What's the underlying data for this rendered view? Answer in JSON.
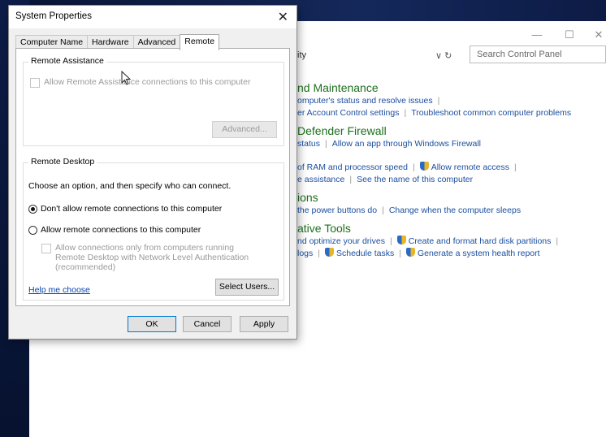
{
  "control_panel": {
    "address": "ity",
    "search_placeholder": "Search Control Panel",
    "minimize": "—",
    "maximize": "☐",
    "close": "✕",
    "sections": [
      {
        "title": "nd Maintenance",
        "rows": [
          [
            "omputer's status and resolve issues"
          ],
          [
            "er Account Control settings",
            "Troubleshoot common computer problems"
          ]
        ]
      },
      {
        "title": "Defender Firewall",
        "rows": [
          [
            "status",
            "Allow an app through Windows Firewall"
          ]
        ]
      },
      {
        "title": "",
        "rows": [
          [
            "of RAM and processor speed",
            "Allow remote access"
          ],
          [
            "e assistance",
            "See the name of this computer"
          ]
        ]
      },
      {
        "title": "ions",
        "rows": [
          [
            "the power buttons do",
            "Change when the computer sleeps"
          ]
        ]
      },
      {
        "title": "ative Tools",
        "rows": [
          [
            "nd optimize your drives",
            "Create and format hard disk partitions"
          ],
          [
            "logs",
            "Schedule tasks",
            "Generate a system health report"
          ]
        ]
      }
    ]
  },
  "dialog": {
    "title": "System Properties",
    "close": "✕",
    "tabs": [
      "Computer Name",
      "Hardware",
      "Advanced",
      "Remote"
    ],
    "active_tab": "Remote",
    "remote_assistance": {
      "legend": "Remote Assistance",
      "allow_label": "Allow Remote Assistance connections to this computer",
      "advanced_button": "Advanced..."
    },
    "remote_desktop": {
      "legend": "Remote Desktop",
      "instruction": "Choose an option, and then specify who can connect.",
      "option_deny": "Don't allow remote connections to this computer",
      "option_allow": "Allow remote connections to this computer",
      "nla_label": "Allow connections only from computers running Remote Desktop with Network Level Authentication (recommended)",
      "help_link": "Help me choose",
      "select_users_button": "Select Users..."
    },
    "buttons": {
      "ok": "OK",
      "cancel": "Cancel",
      "apply": "Apply"
    }
  }
}
